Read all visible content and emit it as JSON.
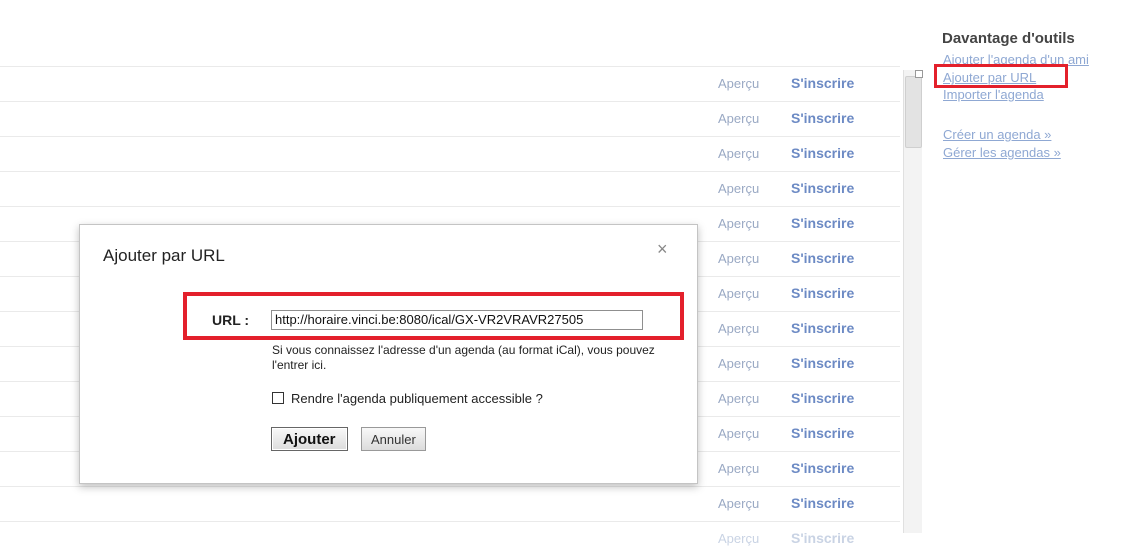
{
  "rows": [
    {
      "preview": "Aperçu",
      "subscribe": "S'inscrire"
    },
    {
      "preview": "Aperçu",
      "subscribe": "S'inscrire"
    },
    {
      "preview": "Aperçu",
      "subscribe": "S'inscrire"
    },
    {
      "preview": "Aperçu",
      "subscribe": "S'inscrire"
    },
    {
      "preview": "Aperçu",
      "subscribe": "S'inscrire"
    },
    {
      "preview": "Aperçu",
      "subscribe": "S'inscrire"
    },
    {
      "preview": "Aperçu",
      "subscribe": "S'inscrire"
    },
    {
      "preview": "Aperçu",
      "subscribe": "S'inscrire"
    },
    {
      "preview": "Aperçu",
      "subscribe": "S'inscrire"
    },
    {
      "preview": "Aperçu",
      "subscribe": "S'inscrire"
    },
    {
      "preview": "Aperçu",
      "subscribe": "S'inscrire"
    },
    {
      "preview": "Aperçu",
      "subscribe": "S'inscrire"
    },
    {
      "preview": "Aperçu",
      "subscribe": "S'inscrire"
    },
    {
      "preview": "Aperçu",
      "subscribe": "S'inscrire"
    }
  ],
  "right_panel": {
    "title": "Davantage d'outils",
    "links": [
      "Ajouter l'agenda d'un ami",
      "Ajouter par URL",
      "Importer l'agenda",
      "Créer un agenda »",
      "Gérer les agendas »"
    ]
  },
  "dialog": {
    "title": "Ajouter par URL",
    "close": "×",
    "url_label": "URL :",
    "url_value": "http://horaire.vinci.be:8080/ical/GX-VR2VRAVR27505",
    "help_text": "Si vous connaissez l'adresse d'un agenda (au format iCal), vous pouvez l'entrer ici.",
    "public_label": "Rendre l'agenda publiquement accessible ?",
    "public_checked": false,
    "add_button": "Ajouter",
    "cancel_button": "Annuler"
  },
  "colors": {
    "highlight": "#e3202b",
    "link": "#8fa8d3",
    "subscribe": "#6c8ac4"
  }
}
